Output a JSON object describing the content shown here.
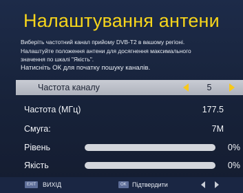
{
  "title": "Налаштування антени",
  "instructions": [
    "Виберіть частотний канал прийому DVB-T2 в вашому регіоні.",
    "Налаштуйте положення антени для досягнення максимального",
    "значення по шкалі \"Якість\".",
    "Натисніть ОК для початку пошуку каналів."
  ],
  "rows": {
    "channel": {
      "label": "Частота каналу",
      "value": "5"
    },
    "frequency": {
      "label": "Частота (МГц)",
      "value": "177.5"
    },
    "bandwidth": {
      "label": "Смуга:",
      "value": "7M"
    },
    "level": {
      "label": "Рівень",
      "value": "0%",
      "fraction": 0.0
    },
    "quality": {
      "label": "Якість",
      "value": "0%",
      "fraction": 0.0
    }
  },
  "footer": {
    "exit_key": "EXIT",
    "exit_label": "ВИХІД",
    "ok_key": "OK",
    "ok_label": "Підтвердити"
  },
  "colors": {
    "accent": "#f7d51b",
    "selection": "#bfc3cb",
    "background": "#18223a",
    "key_badge": "#5e6e99"
  }
}
